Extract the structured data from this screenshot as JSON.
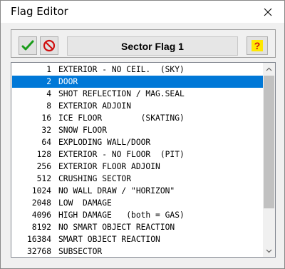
{
  "window": {
    "title": "Flag Editor"
  },
  "toolbar": {
    "ok_icon": "green-checkmark-icon",
    "cancel_icon": "red-no-symbol-icon",
    "help_icon": "yellow-question-mark-icon",
    "sector_title": "Sector Flag 1",
    "help_label": "?"
  },
  "list": {
    "selected_index": 1,
    "items": [
      {
        "value": "1",
        "label": "EXTERIOR - NO CEIL.  (SKY)"
      },
      {
        "value": "2",
        "label": "DOOR"
      },
      {
        "value": "4",
        "label": "SHOT REFLECTION / MAG.SEAL"
      },
      {
        "value": "8",
        "label": "EXTERIOR ADJOIN"
      },
      {
        "value": "16",
        "label": "ICE FLOOR        (SKATING)"
      },
      {
        "value": "32",
        "label": "SNOW FLOOR"
      },
      {
        "value": "64",
        "label": "EXPLODING WALL/DOOR"
      },
      {
        "value": "128",
        "label": "EXTERIOR - NO FLOOR  (PIT)"
      },
      {
        "value": "256",
        "label": "EXTERIOR FLOOR ADJOIN"
      },
      {
        "value": "512",
        "label": "CRUSHING SECTOR"
      },
      {
        "value": "1024",
        "label": "NO WALL DRAW / \"HORIZON\""
      },
      {
        "value": "2048",
        "label": "LOW  DAMAGE"
      },
      {
        "value": "4096",
        "label": "HIGH DAMAGE   (both = GAS)"
      },
      {
        "value": "8192",
        "label": "NO SMART OBJECT REACTION"
      },
      {
        "value": "16384",
        "label": "SMART OBJECT REACTION"
      },
      {
        "value": "32768",
        "label": "SUBSECTOR"
      }
    ]
  },
  "colors": {
    "selection": "#0078d7",
    "ok_check": "#1a9c1a",
    "cancel_symbol": "#d01010",
    "help_background": "#ffe800",
    "help_mark": "#d01010"
  }
}
